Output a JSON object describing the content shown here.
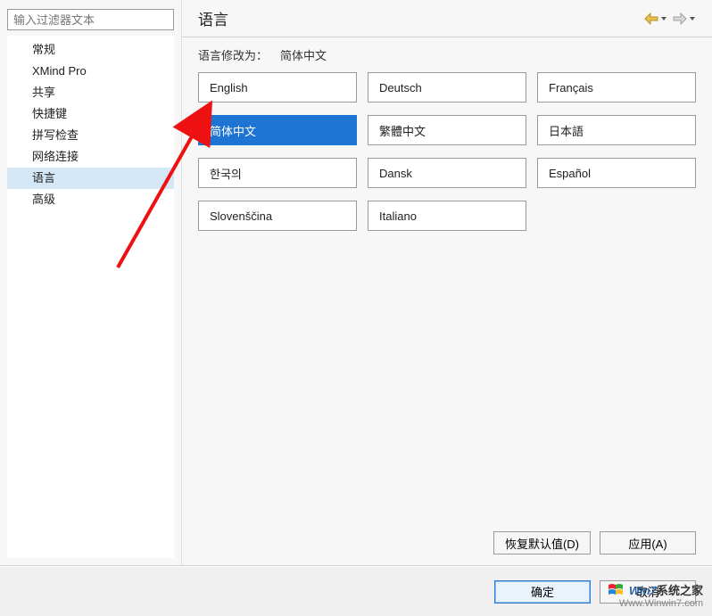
{
  "sidebar": {
    "filter_placeholder": "输入过滤器文本",
    "items": [
      {
        "label": "常规",
        "selected": false
      },
      {
        "label": "XMind Pro",
        "selected": false
      },
      {
        "label": "共享",
        "selected": false
      },
      {
        "label": "快捷键",
        "selected": false
      },
      {
        "label": "拼写检查",
        "selected": false
      },
      {
        "label": "网络连接",
        "selected": false
      },
      {
        "label": "语言",
        "selected": true
      },
      {
        "label": "高级",
        "selected": false
      }
    ]
  },
  "header": {
    "title": "语言"
  },
  "lang_label": {
    "prefix": "语言修改为：",
    "current": "简体中文"
  },
  "languages": [
    {
      "label": "English",
      "selected": false
    },
    {
      "label": "Deutsch",
      "selected": false
    },
    {
      "label": "Français",
      "selected": false
    },
    {
      "label": "简体中文",
      "selected": true
    },
    {
      "label": "繁體中文",
      "selected": false
    },
    {
      "label": "日本語",
      "selected": false
    },
    {
      "label": "한국의",
      "selected": false
    },
    {
      "label": "Dansk",
      "selected": false
    },
    {
      "label": "Español",
      "selected": false
    },
    {
      "label": "Slovenščina",
      "selected": false
    },
    {
      "label": "Italiano",
      "selected": false
    }
  ],
  "buttons": {
    "restore_defaults": "恢复默认值(D)",
    "restore_defaults_key": "D",
    "apply": "应用(A)",
    "apply_key": "A",
    "ok": "确定",
    "cancel": "取消"
  },
  "watermark": {
    "brand_prefix": "Win",
    "brand_seven": "7",
    "brand_cn": "系统之家",
    "url": "Www.Winwin7.com"
  }
}
